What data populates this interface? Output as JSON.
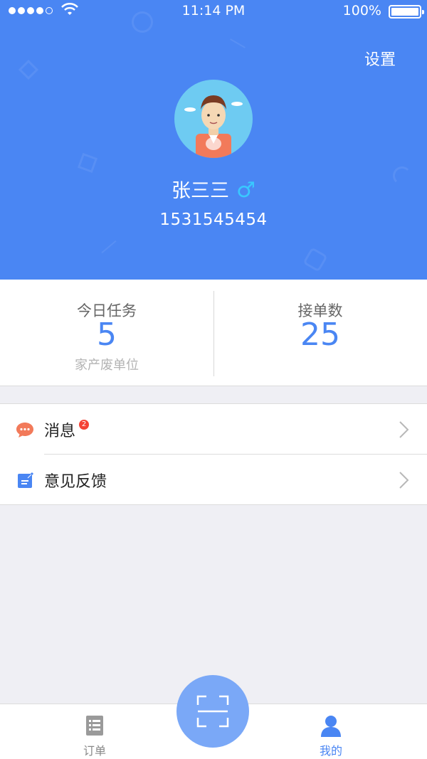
{
  "status_bar": {
    "time": "11:14 PM",
    "battery": "100%"
  },
  "header": {
    "settings_label": "设置",
    "username": "张三三",
    "gender_symbol": "♂",
    "phone": "1531545454"
  },
  "stats": {
    "today_tasks": {
      "label": "今日任务",
      "value": "5",
      "subtitle": "家产废单位"
    },
    "orders_taken": {
      "label": "接单数",
      "value": "25"
    }
  },
  "menu": {
    "items": [
      {
        "label": "消息",
        "badge": "2",
        "icon": "message-icon"
      },
      {
        "label": "意见反馈",
        "icon": "feedback-icon"
      }
    ]
  },
  "tabbar": {
    "orders_label": "订单",
    "mine_label": "我的",
    "scan_icon": "scan-icon"
  },
  "colors": {
    "primary": "#4a86f3",
    "badge": "#f44336",
    "scan_button": "#7aa8f7",
    "gender": "#39c8ff"
  }
}
